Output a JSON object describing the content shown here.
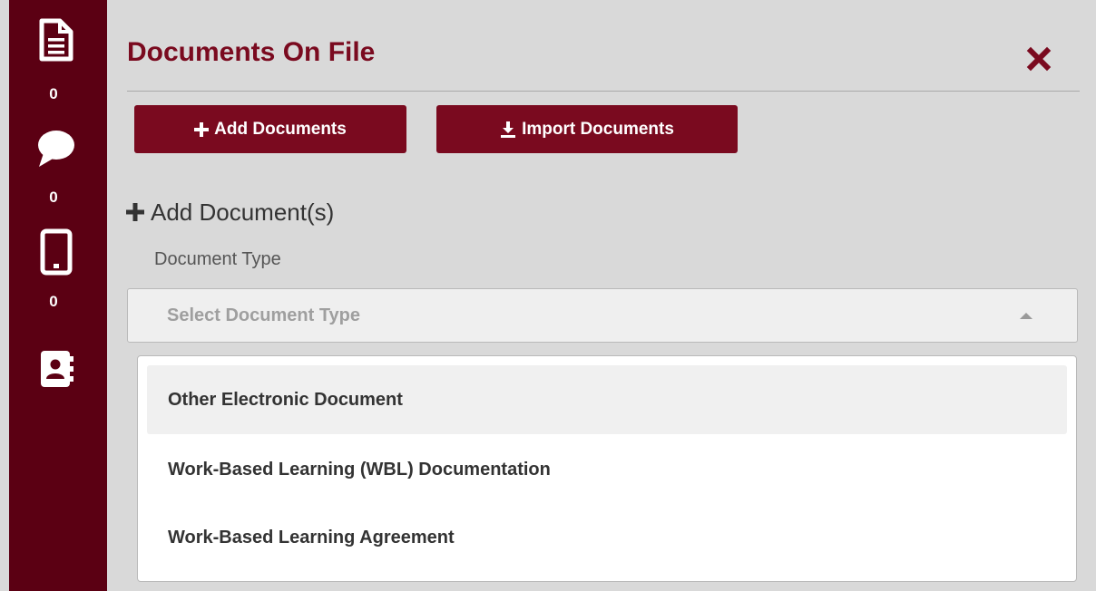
{
  "sidebar": {
    "items": [
      {
        "icon": "document-icon",
        "count": "0"
      },
      {
        "icon": "chat-bubble-icon",
        "count": "0"
      },
      {
        "icon": "mobile-phone-icon",
        "count": "0"
      },
      {
        "icon": "contact-book-icon"
      }
    ]
  },
  "panel": {
    "title": "Documents On File",
    "close_icon": "close-icon"
  },
  "toolbar": {
    "add_label": "Add Documents",
    "add_icon": "plus-icon",
    "import_label": "Import Documents",
    "import_icon": "download-icon"
  },
  "section": {
    "heading": "Add Document(s)",
    "heading_icon": "plus-icon"
  },
  "form": {
    "document_type_label": "Document Type",
    "select_placeholder": "Select Document Type",
    "select_icon": "caret-up-icon",
    "options": [
      {
        "label": "Other Electronic Document",
        "highlighted": true
      },
      {
        "label": "Work-Based Learning (WBL) Documentation",
        "highlighted": false
      },
      {
        "label": "Work-Based Learning Agreement",
        "highlighted": false
      }
    ]
  },
  "colors": {
    "brand_maroon": "#7a0a1f",
    "sidebar_bg": "#5b0013",
    "panel_bg": "#d9d9d9"
  }
}
